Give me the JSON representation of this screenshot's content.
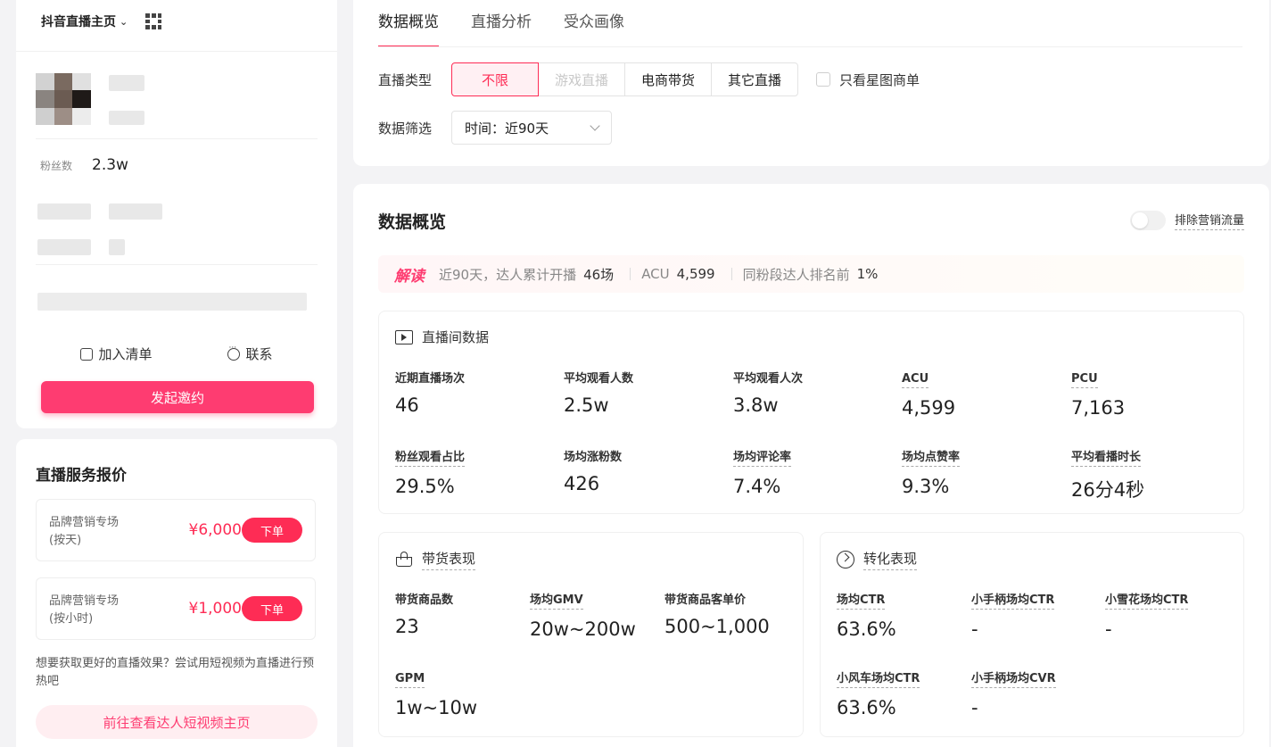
{
  "sidebar": {
    "home_label": "抖音直播主页",
    "fans_label": "粉丝数",
    "fans_value": "2.3w",
    "add_list_label": "加入清单",
    "contact_label": "联系",
    "invite_label": "发起邀约"
  },
  "pricing": {
    "title": "直播服务报价",
    "items": [
      {
        "name_line1": "品牌营销专场",
        "name_line2": "(按天)",
        "price": "¥6,000",
        "order_label": "下单"
      },
      {
        "name_line1": "品牌营销专场",
        "name_line2": "(按小时)",
        "price": "¥1,000",
        "order_label": "下单"
      }
    ],
    "tip": "想要获取更好的直播效果？尝试用短视频为直播进行预热吧",
    "goto_label": "前往查看达人短视频主页"
  },
  "tabs": [
    {
      "label": "数据概览",
      "active": true
    },
    {
      "label": "直播分析",
      "active": false
    },
    {
      "label": "受众画像",
      "active": false
    }
  ],
  "filters": {
    "type_label": "直播类型",
    "type_options": [
      {
        "label": "不限",
        "state": "active"
      },
      {
        "label": "游戏直播",
        "state": "disabled"
      },
      {
        "label": "电商带货",
        "state": "normal"
      },
      {
        "label": "其它直播",
        "state": "normal"
      }
    ],
    "star_only_label": "只看星图商单",
    "data_label": "数据筛选",
    "time_select_value": "时间：近90天"
  },
  "overview": {
    "title": "数据概览",
    "exclude_label": "排除营销流量",
    "insight": {
      "tag": "解读",
      "text1": "近90天，达人累计开播",
      "val1": "46场",
      "text2": "ACU",
      "val2": "4,599",
      "text3": "同粉段达人排名前",
      "val3": "1%"
    },
    "live_panel": {
      "title": "直播间数据",
      "metrics": [
        {
          "label": "近期直播场次",
          "value": "46"
        },
        {
          "label": "平均观看人数",
          "value": "2.5w"
        },
        {
          "label": "平均观看人次",
          "value": "3.8w"
        },
        {
          "label": "ACU",
          "value": "4,599"
        },
        {
          "label": "PCU",
          "value": "7,163"
        },
        {
          "label": "粉丝观看占比",
          "value": "29.5%"
        },
        {
          "label": "场均涨粉数",
          "value": "426"
        },
        {
          "label": "场均评论率",
          "value": "7.4%"
        },
        {
          "label": "场均点赞率",
          "value": "9.3%"
        },
        {
          "label": "平均看播时长",
          "value": "26分4秒"
        }
      ]
    },
    "sales_panel": {
      "title": "带货表现",
      "metrics": [
        {
          "label": "带货商品数",
          "value": "23"
        },
        {
          "label": "场均GMV",
          "value": "20w~200w"
        },
        {
          "label": "带货商品客单价",
          "value": "500~1,000"
        },
        {
          "label": "GPM",
          "value": "1w~10w"
        }
      ]
    },
    "conversion_panel": {
      "title": "转化表现",
      "metrics": [
        {
          "label": "场均CTR",
          "value": "63.6%"
        },
        {
          "label": "小手柄场均CTR",
          "value": "-"
        },
        {
          "label": "小雪花场均CTR",
          "value": "-"
        },
        {
          "label": "小风车场均CTR",
          "value": "63.6%"
        },
        {
          "label": "小手柄场均CVR",
          "value": "-"
        }
      ]
    }
  }
}
